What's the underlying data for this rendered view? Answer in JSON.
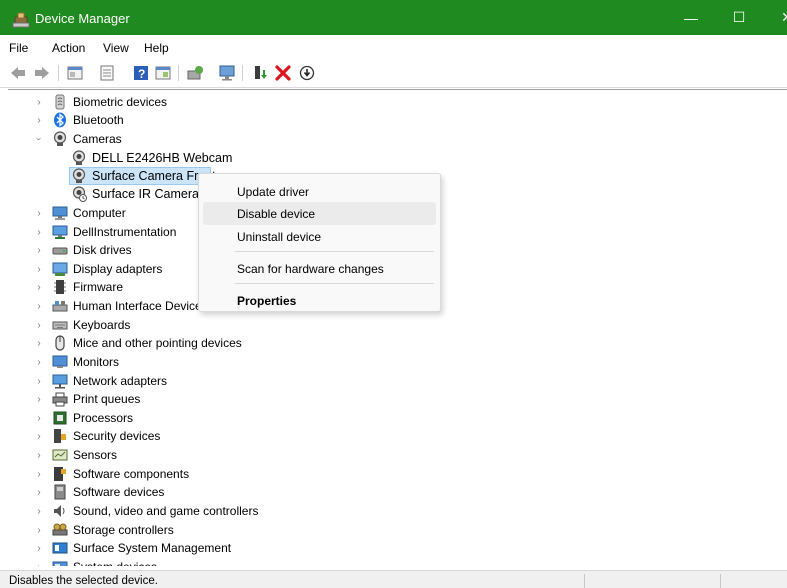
{
  "window": {
    "title": "Device Manager",
    "min_glyph": "—",
    "max_glyph": "☐",
    "close_glyph": "✕",
    "accent": "#1f8a1f"
  },
  "menu": [
    "File",
    "Action",
    "View",
    "Help"
  ],
  "toolbar": [
    "back-arrow-icon",
    "forward-arrow-icon",
    "properties-view-icon",
    "properties-sheet-icon",
    "help-icon",
    "show-hidden-icon",
    "update-driver-icon",
    "scan-hardware-icon",
    "add-driver-icon",
    "uninstall-device-icon",
    "disable-device-icon"
  ],
  "tree": {
    "categories_top": [
      {
        "label": "Biometric devices",
        "icon": "biometric-icon"
      },
      {
        "label": "Bluetooth",
        "icon": "bluetooth-icon"
      }
    ],
    "cameras": {
      "label": "Cameras",
      "icon": "camera-icon",
      "expanded": true,
      "children": [
        {
          "label": "DELL E2426HB Webcam",
          "icon": "webcam-icon"
        },
        {
          "label": "Surface Camera Front",
          "icon": "webcam-icon",
          "selected": true
        },
        {
          "label": "Surface IR Camera Front",
          "icon": "ir-camera-icon"
        }
      ]
    },
    "categories": [
      {
        "label": "Computer",
        "icon": "computer-icon"
      },
      {
        "label": "DellInstrumentation",
        "icon": "dell-instrumentation-icon"
      },
      {
        "label": "Disk drives",
        "icon": "disk-drive-icon"
      },
      {
        "label": "Display adapters",
        "icon": "display-adapter-icon"
      },
      {
        "label": "Firmware",
        "icon": "firmware-icon"
      },
      {
        "label": "Human Interface Devices",
        "icon": "hid-icon"
      },
      {
        "label": "Keyboards",
        "icon": "keyboard-icon"
      },
      {
        "label": "Mice and other pointing devices",
        "icon": "mouse-icon"
      },
      {
        "label": "Monitors",
        "icon": "monitor-icon"
      },
      {
        "label": "Network adapters",
        "icon": "network-adapter-icon"
      },
      {
        "label": "Print queues",
        "icon": "printer-icon"
      },
      {
        "label": "Processors",
        "icon": "processor-icon"
      },
      {
        "label": "Security devices",
        "icon": "security-device-icon"
      },
      {
        "label": "Sensors",
        "icon": "sensor-icon"
      },
      {
        "label": "Software components",
        "icon": "software-component-icon"
      },
      {
        "label": "Software devices",
        "icon": "software-device-icon"
      },
      {
        "label": "Sound, video and game controllers",
        "icon": "sound-icon"
      },
      {
        "label": "Storage controllers",
        "icon": "storage-controller-icon"
      },
      {
        "label": "Surface System Management",
        "icon": "surface-management-icon"
      },
      {
        "label": "System devices",
        "icon": "system-device-icon"
      }
    ]
  },
  "context_menu": {
    "items": [
      "Update driver",
      "Disable device",
      "Uninstall device",
      "Scan for hardware changes",
      "Properties"
    ],
    "hovered": "Disable device"
  },
  "statusbar": {
    "text": "Disables the selected device."
  }
}
